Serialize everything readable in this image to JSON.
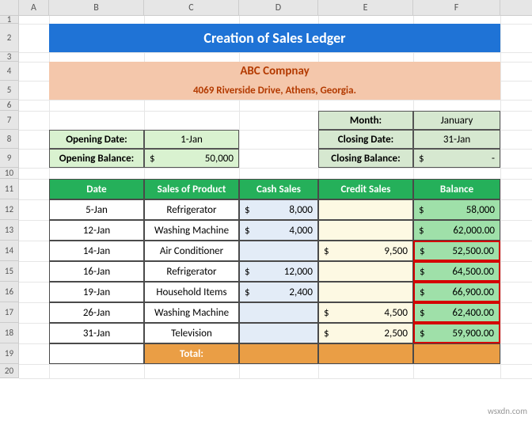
{
  "columns": [
    "A",
    "B",
    "C",
    "D",
    "E",
    "F"
  ],
  "row_count": 20,
  "title": "Creation of Sales Ledger",
  "company": {
    "name": "ABC Compnay",
    "address": "4069 Riverside Drive, Athens, Georgia."
  },
  "opening": {
    "date_label": "Opening Date:",
    "date_value": "1-Jan",
    "balance_label": "Opening Balance:",
    "balance_currency": "$",
    "balance_value": "50,000"
  },
  "closing": {
    "month_label": "Month:",
    "month_value": "January",
    "date_label": "Closing Date:",
    "date_value": "31-Jan",
    "balance_label": "Closing Balance:",
    "balance_currency": "$",
    "balance_value": "-"
  },
  "headers": {
    "date": "Date",
    "product": "Sales of Product",
    "cash": "Cash Sales",
    "credit": "Credit Sales",
    "balance": "Balance"
  },
  "rows": [
    {
      "date": "5-Jan",
      "product": "Refrigerator",
      "cash": "8,000",
      "credit": "",
      "balance": "58,000",
      "bal_dec": false,
      "red": false
    },
    {
      "date": "12-Jan",
      "product": "Washing Machine",
      "cash": "4,000",
      "credit": "",
      "balance": "62,000.00",
      "bal_dec": true,
      "red": false
    },
    {
      "date": "14-Jan",
      "product": "Air Conditioner",
      "cash": "",
      "credit": "9,500",
      "balance": "52,500.00",
      "bal_dec": true,
      "red": true
    },
    {
      "date": "16-Jan",
      "product": "Refrigerator",
      "cash": "12,000",
      "credit": "",
      "balance": "64,500.00",
      "bal_dec": true,
      "red": true
    },
    {
      "date": "19-Jan",
      "product": "Household Items",
      "cash": "2,400",
      "credit": "",
      "balance": "66,900.00",
      "bal_dec": true,
      "red": true
    },
    {
      "date": "26-Jan",
      "product": "Washing Machine",
      "cash": "",
      "credit": "4,500",
      "balance": "62,400.00",
      "bal_dec": true,
      "red": true
    },
    {
      "date": "31-Jan",
      "product": "Television",
      "cash": "",
      "credit": "2,500",
      "balance": "59,900.00",
      "bal_dec": true,
      "red": true
    }
  ],
  "total_label": "Total:",
  "currency": "$",
  "watermark": "wsxdn.com",
  "chart_data": {
    "type": "table",
    "title": "Sales Ledger",
    "columns": [
      "Date",
      "Sales of Product",
      "Cash Sales",
      "Credit Sales",
      "Balance"
    ],
    "rows": [
      [
        "5-Jan",
        "Refrigerator",
        8000,
        null,
        58000
      ],
      [
        "12-Jan",
        "Washing Machine",
        4000,
        null,
        62000
      ],
      [
        "14-Jan",
        "Air Conditioner",
        null,
        9500,
        52500
      ],
      [
        "16-Jan",
        "Refrigerator",
        12000,
        null,
        64500
      ],
      [
        "19-Jan",
        "Household Items",
        2400,
        null,
        66900
      ],
      [
        "26-Jan",
        "Washing Machine",
        null,
        4500,
        62400
      ],
      [
        "31-Jan",
        "Television",
        null,
        2500,
        59900
      ]
    ],
    "opening_balance": 50000,
    "month": "January"
  }
}
